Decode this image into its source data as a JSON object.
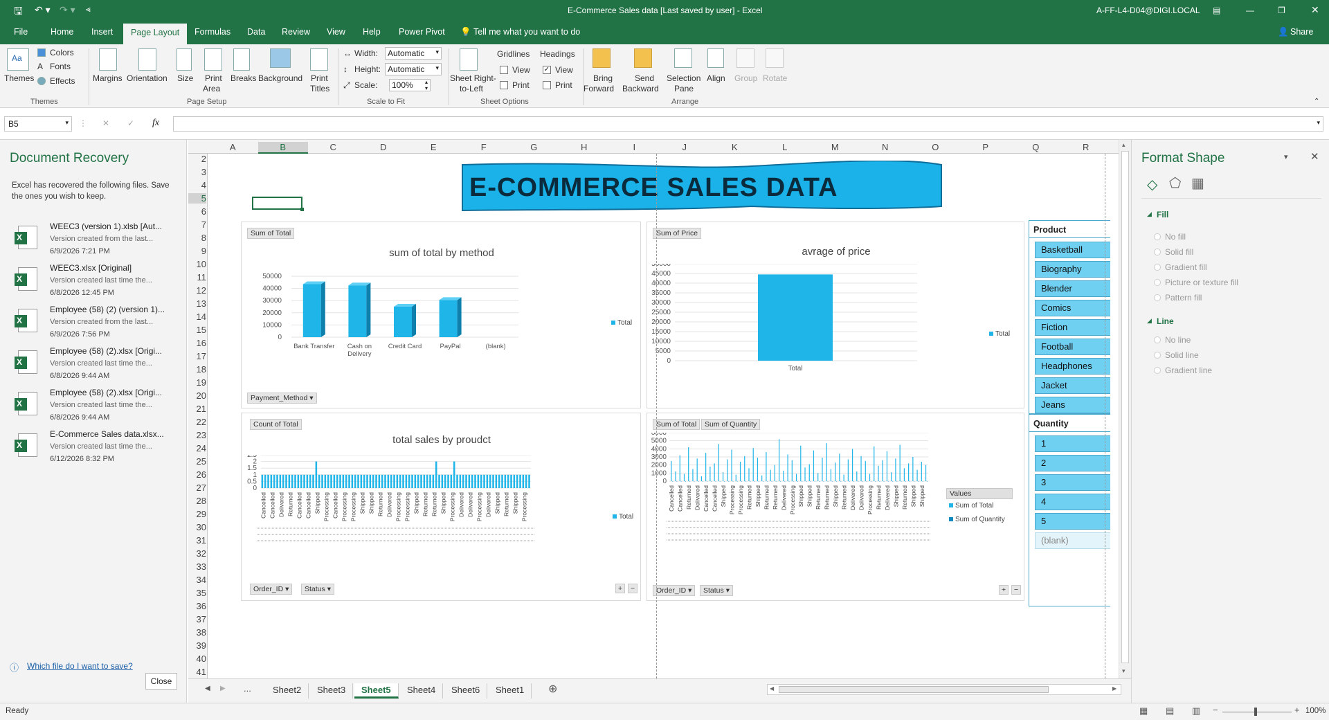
{
  "window": {
    "title": "E-Commerce Sales data [Last saved by user]  -  Excel",
    "user": "A-FF-L4-D04@DIGI.LOCAL"
  },
  "ribbon_tabs": [
    "File",
    "Home",
    "Insert",
    "Page Layout",
    "Formulas",
    "Data",
    "Review",
    "View",
    "Help",
    "Power Pivot"
  ],
  "tell_me": "Tell me what you want to do",
  "share": "Share",
  "ribbon": {
    "themes": "Themes",
    "colors": "Colors",
    "fonts": "Fonts",
    "effects": "Effects",
    "margins": "Margins",
    "orientation": "Orientation",
    "size": "Size",
    "print_area_1": "Print",
    "print_area_2": "Area",
    "breaks": "Breaks",
    "background": "Background",
    "print_titles_1": "Print",
    "print_titles_2": "Titles",
    "width_label": "Width:",
    "width_value": "Automatic",
    "height_label": "Height:",
    "height_value": "Automatic",
    "scale_label": "Scale:",
    "scale_value": "100%",
    "sheet_rtl_1": "Sheet Right-",
    "sheet_rtl_2": "to-Left",
    "gridlines": "Gridlines",
    "headings": "Headings",
    "view": "View",
    "print": "Print",
    "bring_forward_1": "Bring",
    "bring_forward_2": "Forward",
    "send_backward_1": "Send",
    "send_backward_2": "Backward",
    "selection_pane_1": "Selection",
    "selection_pane_2": "Pane",
    "align": "Align",
    "group": "Group",
    "rotate": "Rotate",
    "groups": {
      "themes": "Themes",
      "page_setup": "Page Setup",
      "scale_to_fit": "Scale to Fit",
      "sheet_options": "Sheet Options",
      "arrange": "Arrange"
    }
  },
  "formula_bar": {
    "name_box": "B5",
    "fx": "fx",
    "value": ""
  },
  "doc_recovery": {
    "title": "Document Recovery",
    "intro": "Excel has recovered the following files.  Save the ones you wish to keep.",
    "items": [
      {
        "name": "WEEC3 (version 1).xlsb  [Aut...",
        "sub": "Version created from the last...",
        "date": "6/9/2026 7:21 PM"
      },
      {
        "name": "WEEC3.xlsx  [Original]",
        "sub": "Version created last time the...",
        "date": "6/8/2026 12:45 PM"
      },
      {
        "name": "Employee (58) (2) (version 1)...",
        "sub": "Version created from the last...",
        "date": "6/9/2026 7:56 PM"
      },
      {
        "name": "Employee (58) (2).xlsx  [Origi...",
        "sub": "Version created last time the...",
        "date": "6/8/2026 9:44 AM"
      },
      {
        "name": "Employee (58) (2).xlsx  [Origi...",
        "sub": "Version created last time the...",
        "date": "6/8/2026 9:44 AM"
      },
      {
        "name": "E-Commerce Sales data.xlsx...",
        "sub": "Version created last time the...",
        "date": "6/12/2026 8:32 PM"
      }
    ],
    "help_link": "Which file do I want to save?",
    "close": "Close"
  },
  "columns": [
    "A",
    "B",
    "C",
    "D",
    "E",
    "F",
    "G",
    "H",
    "I",
    "J",
    "K",
    "L",
    "M",
    "N",
    "O",
    "P",
    "Q",
    "R"
  ],
  "rows": [
    "2",
    "3",
    "4",
    "5",
    "6",
    "7",
    "8",
    "9",
    "10",
    "11",
    "12",
    "13",
    "14",
    "15",
    "16",
    "17",
    "18",
    "19",
    "20",
    "21",
    "22",
    "23",
    "24",
    "25",
    "26",
    "27",
    "28",
    "29",
    "30",
    "31",
    "32",
    "33",
    "34",
    "35",
    "36",
    "37",
    "38",
    "39",
    "40",
    "41"
  ],
  "banner": "E-COMMERCE SALES DATA",
  "chart1": {
    "field_button": "Sum of Total",
    "axis_button": "Payment_Method",
    "legend": "Total"
  },
  "chart2": {
    "field_button": "Sum of Price",
    "legend": "Total"
  },
  "chart3": {
    "field_button": "Count of Total",
    "axis_button_1": "Order_ID",
    "axis_button_2": "Status",
    "legend": "Total"
  },
  "chart4": {
    "field_button_1": "Sum of Total",
    "field_button_2": "Sum of Quantity",
    "axis_button_1": "Order_ID",
    "axis_button_2": "Status",
    "legend_header": "Values",
    "legend_1": "Sum of Total",
    "legend_2": "Sum of Quantity"
  },
  "chart_data": [
    {
      "type": "bar",
      "title": "sum of total by method",
      "categories": [
        "Bank Transfer",
        "Cash on Delivery",
        "Credit Card",
        "PayPal",
        "(blank)"
      ],
      "values": [
        43500,
        42500,
        25000,
        30500,
        0
      ],
      "ylim": [
        0,
        50000
      ],
      "yticks": [
        0,
        10000,
        20000,
        30000,
        40000,
        50000
      ],
      "legend": "right"
    },
    {
      "type": "bar",
      "title": "avrage of price",
      "categories": [
        "Total"
      ],
      "values": [
        44500
      ],
      "ylim": [
        0,
        50000
      ],
      "yticks": [
        0,
        5000,
        10000,
        15000,
        20000,
        25000,
        30000,
        35000,
        40000,
        45000,
        50000
      ],
      "legend": "right"
    },
    {
      "type": "bar",
      "title": "total sales by proudct",
      "status_labels": [
        "Cancelled",
        "Cancelled",
        "Delivered",
        "Returned",
        "Cancelled",
        "Cancelled",
        "Shipped",
        "Processing",
        "Cancelled",
        "Processing",
        "Processing",
        "Shipped",
        "Shipped",
        "Returned",
        "Delivered",
        "Processing",
        "Processing",
        "Shipped",
        "Returned",
        "Returned",
        "Shipped",
        "Processing",
        "Delivered",
        "Delivered",
        "Processing",
        "Delivered",
        "Shipped",
        "Returned",
        "Shipped",
        "Processing"
      ],
      "values": [
        1,
        1,
        1,
        1,
        1,
        1,
        1,
        1,
        1,
        1,
        1,
        1,
        1,
        1,
        1,
        1,
        1,
        1,
        2,
        1,
        1,
        1,
        1,
        1,
        1,
        1,
        1,
        1,
        1,
        1,
        1,
        1,
        1,
        1,
        1,
        1,
        1,
        1,
        1,
        1,
        1,
        1,
        1,
        1,
        1,
        1,
        1,
        1,
        1,
        1,
        1,
        1,
        1,
        1,
        1,
        1,
        1,
        1,
        2,
        1,
        1,
        1,
        1,
        1,
        2,
        1,
        1,
        1,
        1,
        1,
        1,
        1,
        1,
        1,
        1,
        1,
        1,
        1,
        1,
        1,
        1,
        1,
        1,
        1,
        1,
        1,
        1,
        1,
        1,
        1
      ],
      "ylim": [
        0,
        2.5
      ],
      "yticks": [
        "0",
        "0.5",
        "1",
        "1.5",
        "2",
        "2.5"
      ],
      "legend": "right"
    },
    {
      "type": "bar",
      "status_labels": [
        "Cancelled",
        "Cancelled",
        "Returned",
        "Delivered",
        "Cancelled",
        "Cancelled",
        "Shipped",
        "Processing",
        "Processing",
        "Returned",
        "Shipped",
        "Returned",
        "Returned",
        "Delivered",
        "Processing",
        "Shipped",
        "Shipped",
        "Returned",
        "Returned",
        "Shipped",
        "Returned",
        "Delivered",
        "Delivered",
        "Processing",
        "Returned",
        "Delivered",
        "Shipped",
        "Returned",
        "Shipped",
        "Shipped"
      ],
      "series": [
        {
          "name": "Sum of Total",
          "values": [
            2500,
            1200,
            3200,
            900,
            4200,
            1500,
            2800,
            600,
            3500,
            1800,
            2200,
            4600,
            1100,
            2700,
            3900,
            800,
            2400,
            3100,
            1600,
            4100,
            2900,
            700,
            3600,
            1400,
            2000,
            5200,
            1300,
            3300,
            2600,
            900,
            4400,
            1700,
            2100,
            3800,
            1000,
            2900,
            4700,
            1500,
            2300,
            3400,
            800,
            2700,
            4000,
            1200,
            3100,
            2500,
            900,
            4300,
            1900,
            2600,
            3700,
            1100,
            2800,
            4500,
            1600,
            2200,
            3000,
            1400,
            2400,
            2000
          ]
        },
        {
          "name": "Sum of Quantity",
          "values": [
            3,
            2,
            5,
            1,
            4,
            2,
            3,
            1,
            5,
            2,
            3,
            4,
            1,
            3,
            5,
            2,
            4,
            3,
            1,
            5,
            2,
            3,
            4,
            1,
            2,
            5,
            3,
            4,
            2,
            1,
            5,
            3,
            2,
            4,
            1,
            3,
            5,
            2,
            4,
            3,
            1,
            2,
            5,
            3,
            4,
            2,
            1,
            5,
            3,
            2,
            4,
            1,
            3,
            5,
            2,
            4,
            3,
            1,
            2,
            3
          ]
        }
      ],
      "ylim": [
        0,
        6000
      ],
      "yticks": [
        0,
        1000,
        2000,
        3000,
        4000,
        5000,
        6000
      ],
      "legend": "right"
    }
  ],
  "slicers": {
    "product_title": "Product",
    "products": [
      "Basketball",
      "Biography",
      "Blender",
      "Comics",
      "Fiction",
      "Football",
      "Headphones",
      "Jacket",
      "Jeans"
    ],
    "quantity_title": "Quantity",
    "quantities": [
      "1",
      "2",
      "3",
      "4",
      "5",
      "(blank)"
    ]
  },
  "format_shape": {
    "title": "Format Shape",
    "fill": "Fill",
    "fill_options": [
      "No fill",
      "Solid fill",
      "Gradient fill",
      "Picture or texture fill",
      "Pattern fill"
    ],
    "line": "Line",
    "line_options": [
      "No line",
      "Solid line",
      "Gradient line"
    ]
  },
  "sheet_tabs": [
    "Sheet2",
    "Sheet3",
    "Sheet5",
    "Sheet4",
    "Sheet6",
    "Sheet1"
  ],
  "active_sheet": "Sheet5",
  "status": {
    "ready": "Ready",
    "zoom": "100%"
  },
  "colors": {
    "excel_green": "#217346",
    "bar_blue": "#1fb5e8",
    "banner_blue": "#1ab2e8"
  }
}
